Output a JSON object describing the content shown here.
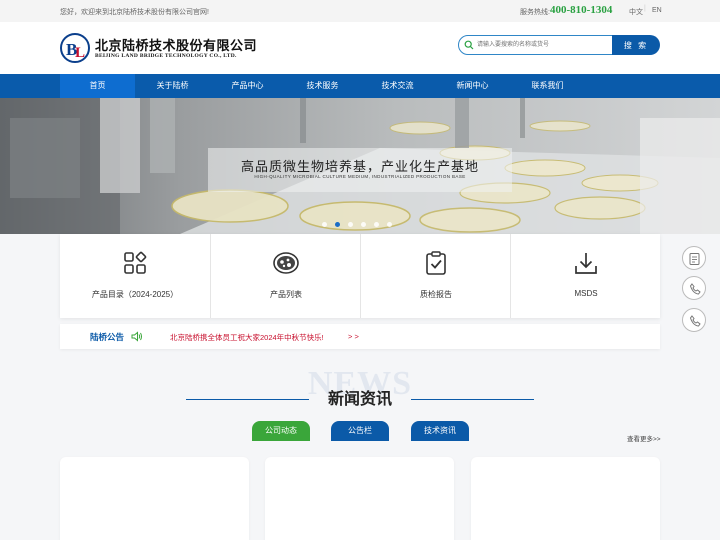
{
  "topbar": {
    "welcome": "您好，欢迎来到北京陆桥技术股份有限公司官网!",
    "hotline_label": "服务热线:",
    "hotline": "400-810-1304",
    "lang_zh": "中文",
    "lang_sep": "|",
    "lang_en": "EN"
  },
  "header": {
    "logo_cn": "北京陆桥技术股份有限公司",
    "logo_en": "BEIJING LAND BRIDGE TECHNOLOGY CO., LTD.",
    "search_placeholder": "请输入要搜索的名称或货号",
    "search_button": "搜 索"
  },
  "nav": {
    "items": [
      "首页",
      "关于陆桥",
      "产品中心",
      "技术服务",
      "技术交流",
      "新闻中心",
      "联系我们"
    ],
    "active": "首页"
  },
  "banner": {
    "title": "高品质微生物培养基，产业化生产基地",
    "subtitle": "HIGH-QUALITY MICROBIAL CULTURE MEDIUM, INDUSTRIALIZED PRODUCTION BASE",
    "slide_count": 6,
    "active_slide": 2
  },
  "quick_links": [
    {
      "label": "产品目录（2024-2025）",
      "icon": "grid-icon"
    },
    {
      "label": "产品列表",
      "icon": "petri-dish-icon"
    },
    {
      "label": "质检报告",
      "icon": "clipboard-check-icon"
    },
    {
      "label": "MSDS",
      "icon": "download-icon"
    }
  ],
  "side_buttons": [
    "document-icon",
    "phone-icon",
    "phone-icon"
  ],
  "notice": {
    "title": "陆桥公告",
    "text": "北京陆桥携全体员工祝大家2024年中秋节快乐!",
    "more": "> >"
  },
  "news": {
    "bg_text": "NEWS",
    "title": "新闻资讯",
    "tabs": [
      "公司动态",
      "公告栏",
      "技术资讯"
    ],
    "more": "查看更多>>"
  },
  "colors": {
    "brand_blue": "#0b5aa8",
    "nav_active": "#0e6dd0",
    "hotline_green": "#2aa142",
    "notice_red": "#c8102e",
    "tab_green": "#3aa63a"
  }
}
